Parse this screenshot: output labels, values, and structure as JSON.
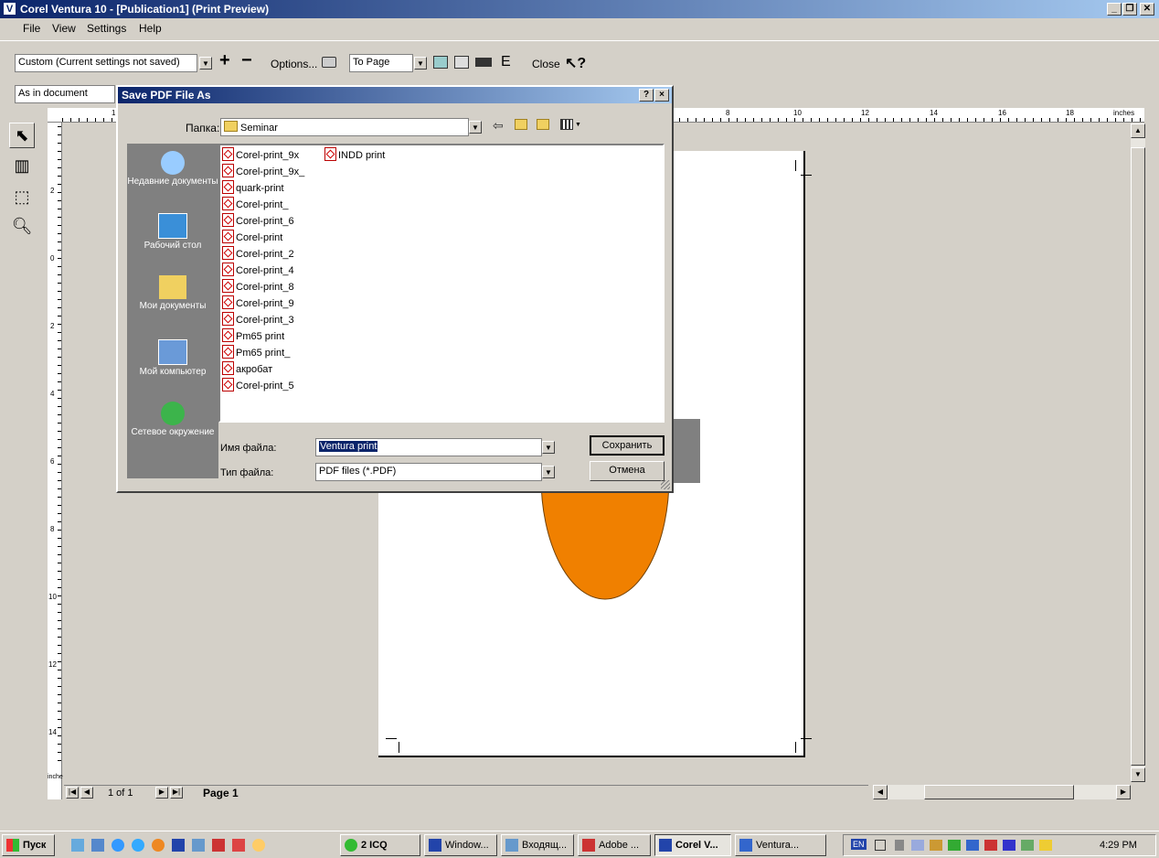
{
  "window": {
    "title": "Corel Ventura 10 - [Publication1] (Print Preview)"
  },
  "menu": [
    "File",
    "View",
    "Settings",
    "Help"
  ],
  "toolbar": {
    "preset": "Custom (Current settings not saved)",
    "options_label": "Options...",
    "zoom": "To Page",
    "e_label": "E",
    "close_label": "Close",
    "plus": "+",
    "minus": "−",
    "as_in_document": "As in document"
  },
  "ruler": {
    "unit": "inches",
    "h_ticks": [
      "1",
      "8",
      "10",
      "12",
      "14",
      "16",
      "18"
    ],
    "v_ticks": [
      "2",
      "0",
      "2",
      "4",
      "6",
      "8",
      "10",
      "12",
      "14"
    ]
  },
  "status": {
    "page_count": "1 of 1",
    "page_tab": "Page 1"
  },
  "dialog": {
    "title": "Save PDF File As",
    "help": "?",
    "close": "×",
    "folder_label": "Папка:",
    "folder": "Seminar",
    "places": [
      {
        "label": "Недавние документы",
        "icon": "recent-documents-icon"
      },
      {
        "label": "Рабочий стол",
        "icon": "desktop-icon"
      },
      {
        "label": "Мои документы",
        "icon": "my-documents-icon"
      },
      {
        "label": "Мой компьютер",
        "icon": "my-computer-icon"
      },
      {
        "label": "Сетевое окружение",
        "icon": "network-icon"
      }
    ],
    "files_col1": [
      "Corel-print_9x",
      "Corel-print_9x_",
      "quark-print",
      "Corel-print_",
      "Corel-print_6",
      "Corel-print",
      "Corel-print_2",
      "Corel-print_4",
      "Corel-print_8",
      "Corel-print_9",
      "Corel-print_3",
      "Pm65 print",
      "Pm65 print_",
      "акробат",
      "Corel-print_5"
    ],
    "files_col2": [
      "INDD print"
    ],
    "filename_label": "Имя файла:",
    "filename": "Ventura print",
    "filetype_label": "Тип файла:",
    "filetype": "PDF files (*.PDF)",
    "save_button": "Сохранить",
    "cancel_button": "Отмена"
  },
  "taskbar": {
    "start": "Пуск",
    "tasks": [
      "2 ICQ",
      "Window...",
      "Входящ...",
      "Adobe ...",
      "Corel V...",
      "Ventura..."
    ],
    "lang": "EN",
    "time": "4:29 PM"
  },
  "colors": {
    "ellipse": "#f08000",
    "title_start": "#0a246a",
    "title_end": "#a6caf0"
  }
}
